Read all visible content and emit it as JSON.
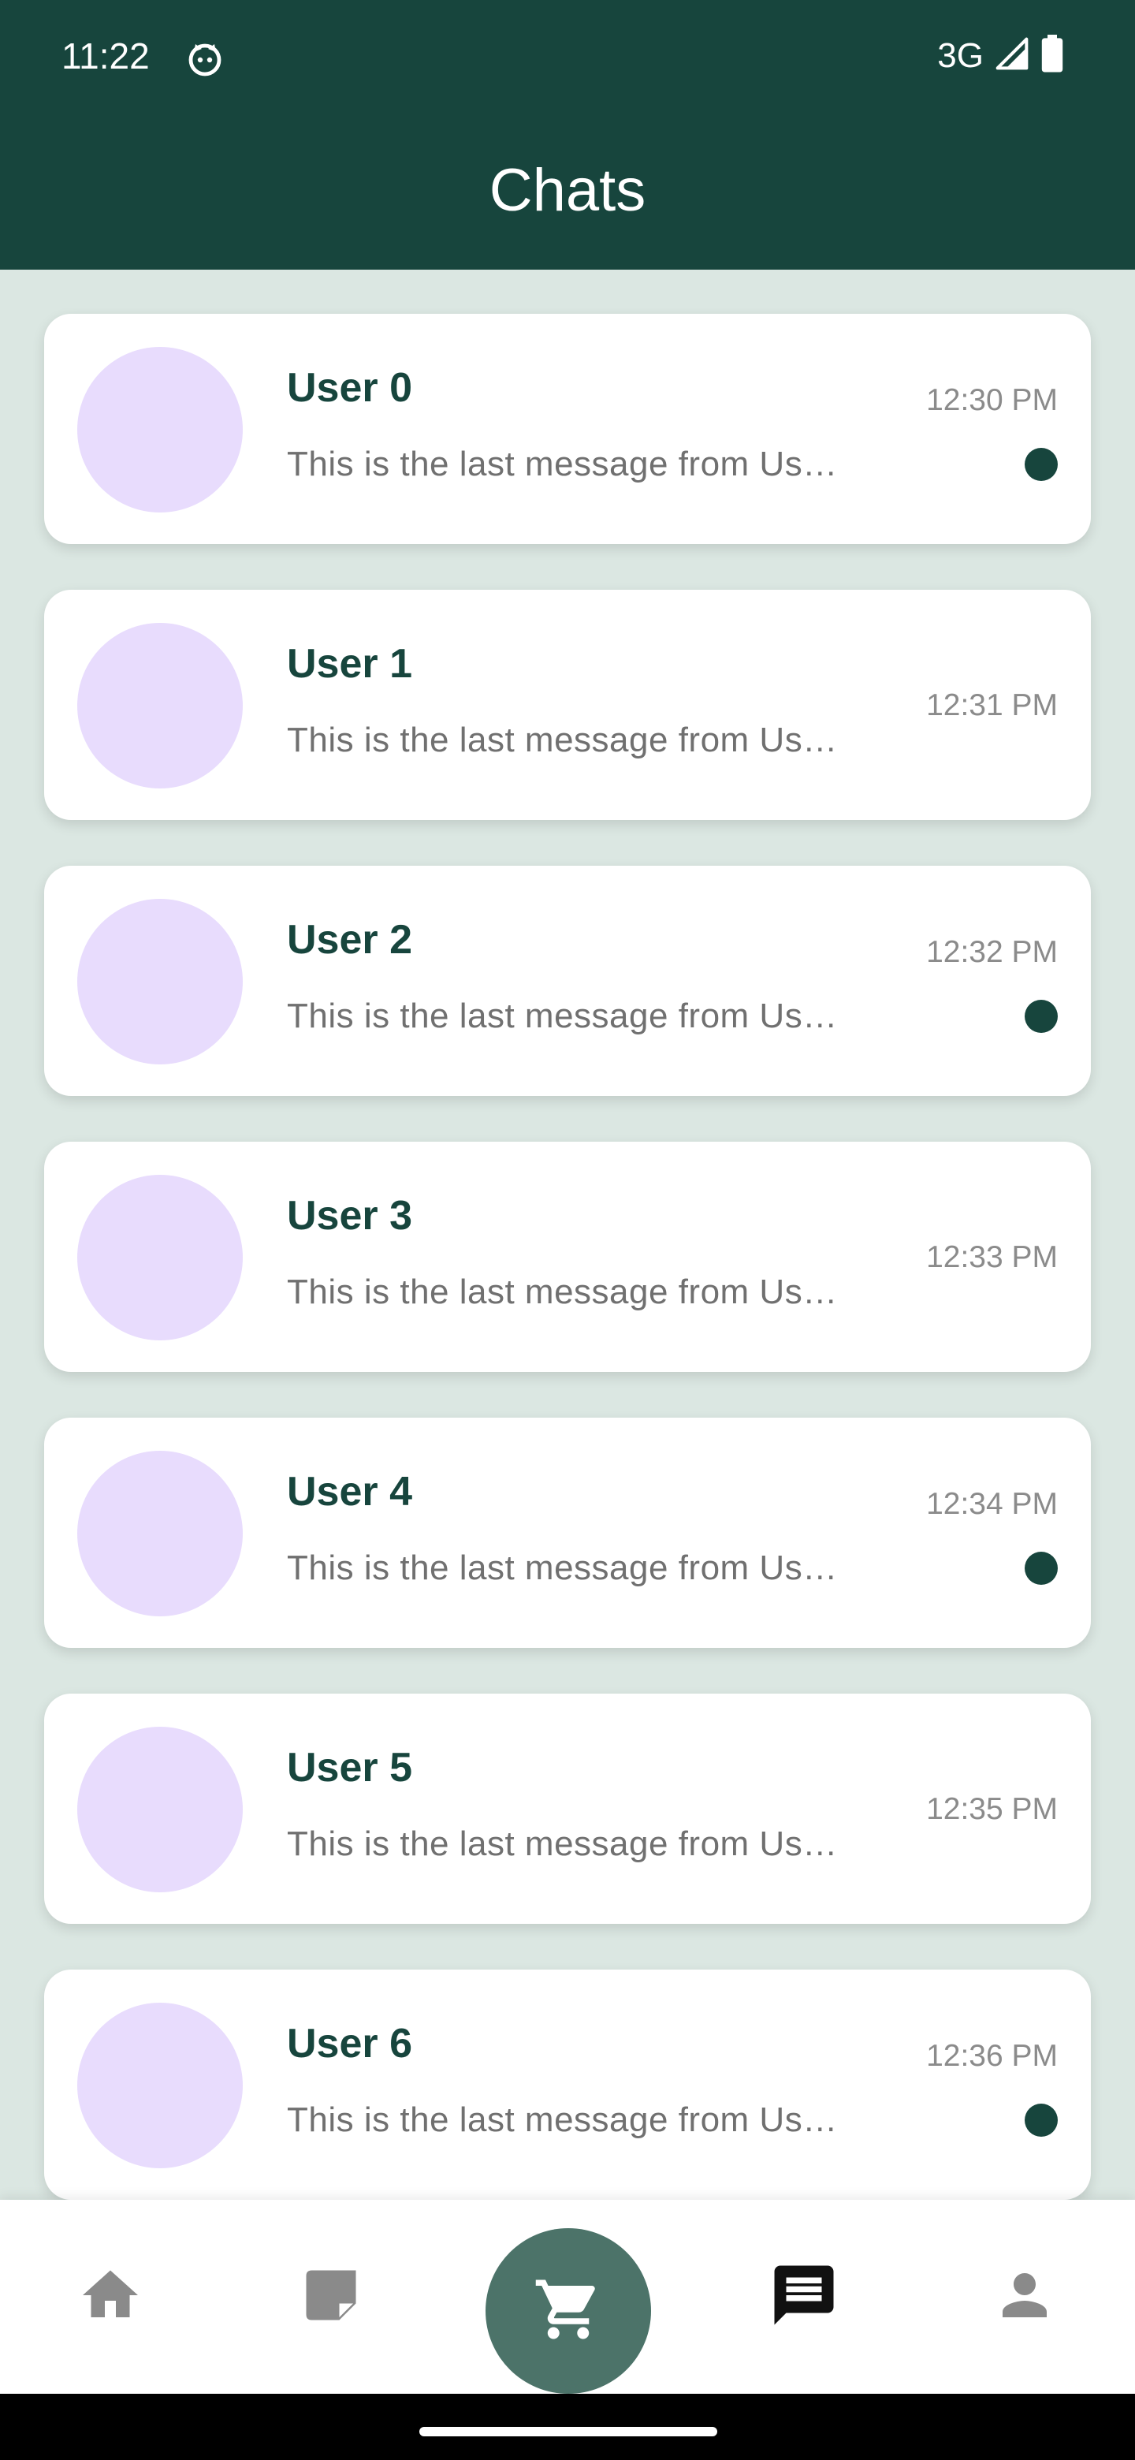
{
  "status_bar": {
    "time": "11:22",
    "network": "3G"
  },
  "header": {
    "title": "Chats"
  },
  "chats": [
    {
      "name": "User 0",
      "message": "This is the last message from Us…",
      "time": "12:30 PM",
      "unread": true
    },
    {
      "name": "User 1",
      "message": "This is the last message from Us…",
      "time": "12:31 PM",
      "unread": false
    },
    {
      "name": "User 2",
      "message": "This is the last message from Us…",
      "time": "12:32 PM",
      "unread": true
    },
    {
      "name": "User 3",
      "message": "This is the last message from Us…",
      "time": "12:33 PM",
      "unread": false
    },
    {
      "name": "User 4",
      "message": "This is the last message from Us…",
      "time": "12:34 PM",
      "unread": true
    },
    {
      "name": "User 5",
      "message": "This is the last message from Us…",
      "time": "12:35 PM",
      "unread": false
    },
    {
      "name": "User 6",
      "message": "This is the last message from Us…",
      "time": "12:36 PM",
      "unread": true
    }
  ],
  "bottom_nav": {
    "items": [
      {
        "icon": "home-icon",
        "active": false
      },
      {
        "icon": "note-icon",
        "active": false
      },
      {
        "icon": "cart-icon",
        "active": false
      },
      {
        "icon": "chat-icon",
        "active": true
      },
      {
        "icon": "person-icon",
        "active": false
      }
    ]
  },
  "colors": {
    "primary": "#17453d",
    "background": "#dbe7e2",
    "card": "#ffffff",
    "avatar": "#e8dcfd",
    "fab": "#4c7369",
    "nav_inactive": "#8a8a8a",
    "nav_active": "#111111"
  }
}
